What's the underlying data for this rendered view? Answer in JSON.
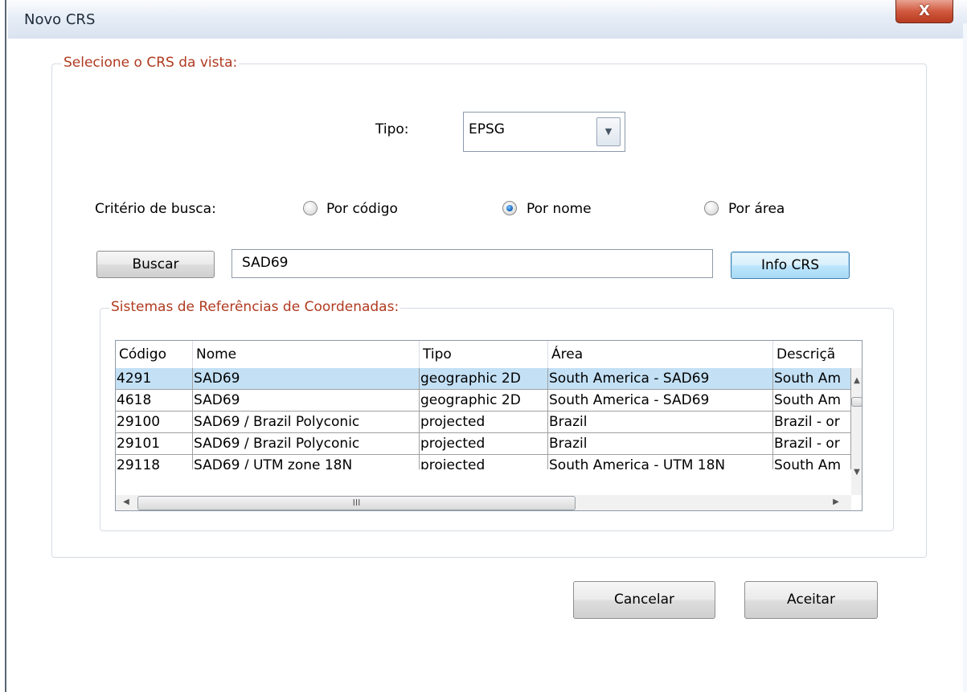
{
  "window": {
    "title": "Novo CRS",
    "close_label": "X"
  },
  "group_main": {
    "legend": "Selecione o CRS da vista:"
  },
  "tipo": {
    "label": "Tipo:",
    "value": "EPSG"
  },
  "criterio": {
    "label": "Critério de busca:",
    "options": [
      {
        "label": "Por código",
        "checked": false
      },
      {
        "label": "Por nome",
        "checked": true
      },
      {
        "label": "Por área",
        "checked": false
      }
    ]
  },
  "search": {
    "button_label": "Buscar",
    "value": "SAD69",
    "info_label": "Info CRS"
  },
  "table": {
    "legend": "Sistemas de Referências de Coordenadas:",
    "columns": [
      "Código",
      "Nome",
      "Tipo",
      "Área",
      "Descriçã"
    ],
    "rows": [
      [
        "4291",
        "SAD69",
        "geographic 2D",
        "South America - SAD69",
        "South Am"
      ],
      [
        "4618",
        "SAD69",
        "geographic 2D",
        "South America - SAD69",
        "South Am"
      ],
      [
        "29100",
        "SAD69 / Brazil Polyconic",
        "projected",
        "Brazil",
        "Brazil - or"
      ],
      [
        "29101",
        "SAD69 / Brazil Polyconic",
        "projected",
        "Brazil",
        "Brazil - or"
      ],
      [
        "29118",
        "SAD69 / UTM zone 18N",
        "projected",
        "South America - UTM 18N",
        "South Am"
      ]
    ],
    "selected_row": 0,
    "hscroll_glyph": "III"
  },
  "footer": {
    "cancel_label": "Cancelar",
    "accept_label": "Aceitar"
  },
  "colors": {
    "legend": "#b03a1f",
    "selection": "#c3e0f5",
    "close": "#c9462b"
  }
}
